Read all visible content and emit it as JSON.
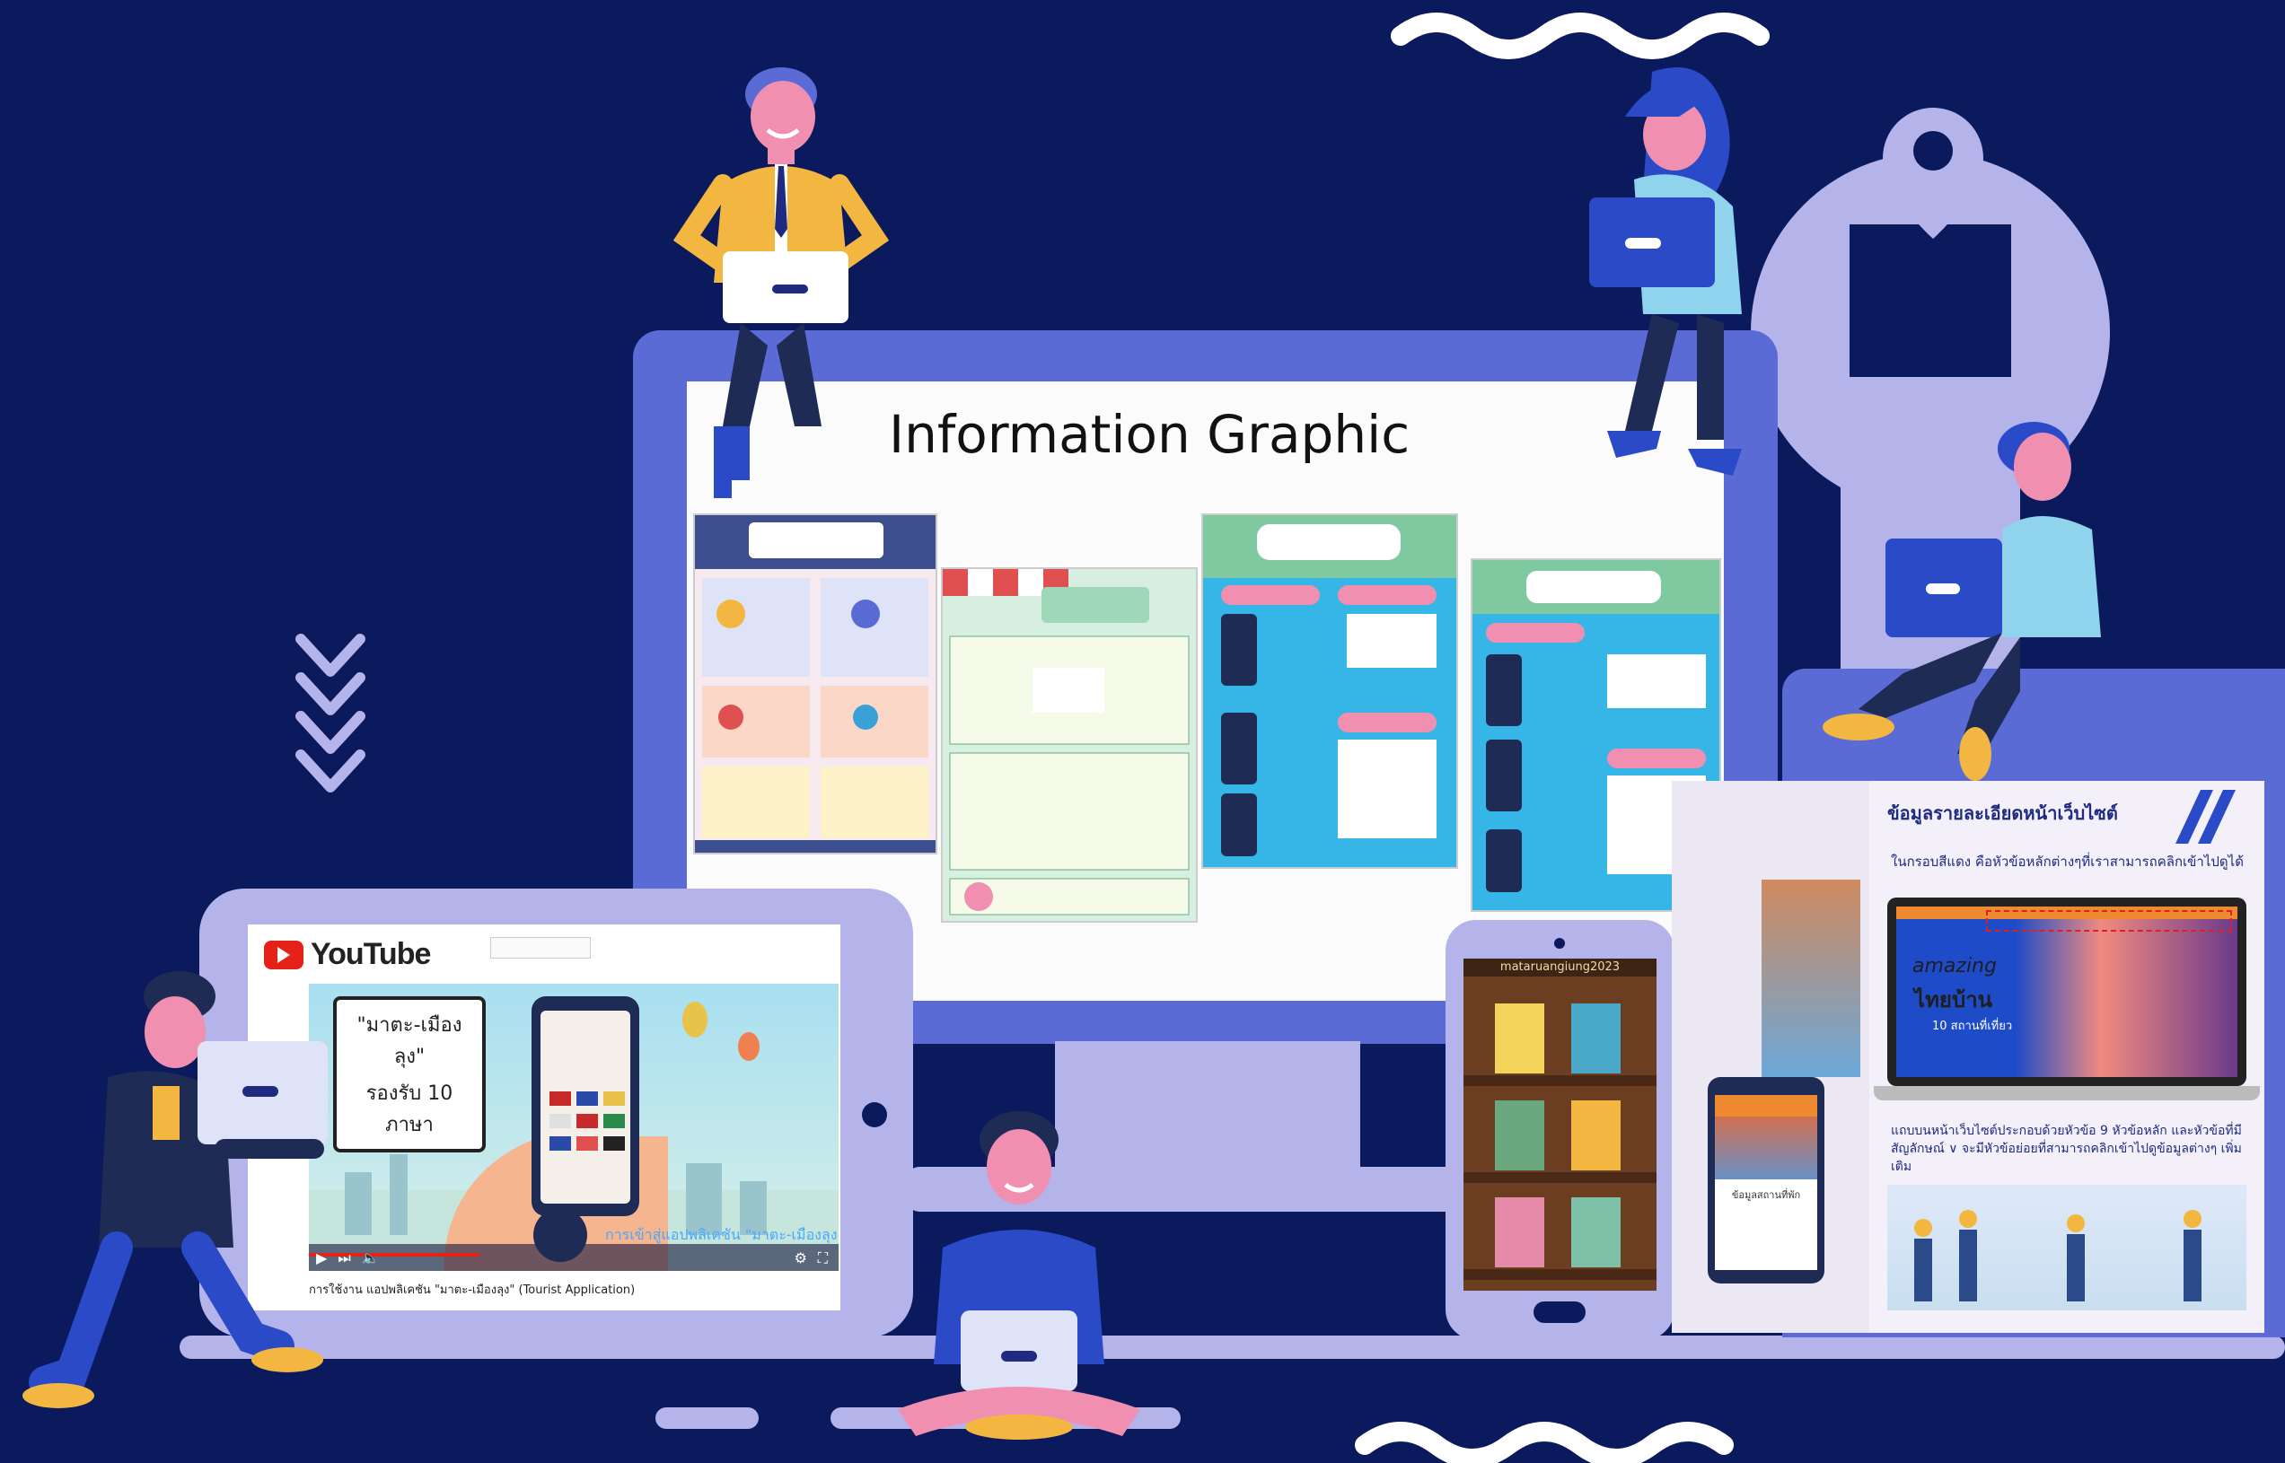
{
  "heading": "Information Graphic",
  "infographics": [
    {
      "name": "infographic-1",
      "accent": "#e8d9ef"
    },
    {
      "name": "infographic-2",
      "accent": "#9fd8b8"
    },
    {
      "name": "infographic-3",
      "accent": "#36b6e6"
    },
    {
      "name": "infographic-4",
      "accent": "#36b6e6"
    }
  ],
  "youtube": {
    "logo": "YouTube",
    "bubble_line1": "\"มาตะ-เมืองลุง\"",
    "bubble_line2": "รองรับ 10 ภาษา",
    "video_caption": "การเข้าสู่แอปพลิเคชัน \"มาตะ-เมืองลุง\"",
    "video_title": "การใช้งาน แอปพลิเคชัน \"มาตะ-เมืองลุง\" (Tourist Application)"
  },
  "phone_shelf": {
    "header": "mataruangiung2023"
  },
  "website_book": {
    "page_title": "ข้อมูลรายละเอียดหน้าเว็บไซต์",
    "intro": "ในกรอบสีแดง คือหัวข้อหลักต่างๆที่เราสามารถคลิกเข้าไปดูได้",
    "hero_text_1": "amazing",
    "hero_text_2": "ไทยบ้าน",
    "hero_sub": "10 สถานที่เที่ยว",
    "body_text": "แถบบนหน้าเว็บไซต์ประกอบด้วยหัวข้อ 9 หัวข้อหลัก และหัวข้อที่มีสัญลักษณ์ ∨ จะมีหัวข้อย่อยที่สามารถคลิกเข้าไปดูข้อมูลต่างๆ เพิ่มเติม",
    "phone_label": "ข้อมูลสถานที่พัก"
  },
  "colors": {
    "background": "#0a1a5c",
    "monitor_frame": "#5b6bd6",
    "light_purple": "#b4b3ea",
    "accent_yellow": "#f3b640",
    "skin": "#f08fb0",
    "shirt_light": "#8fd3ec"
  }
}
